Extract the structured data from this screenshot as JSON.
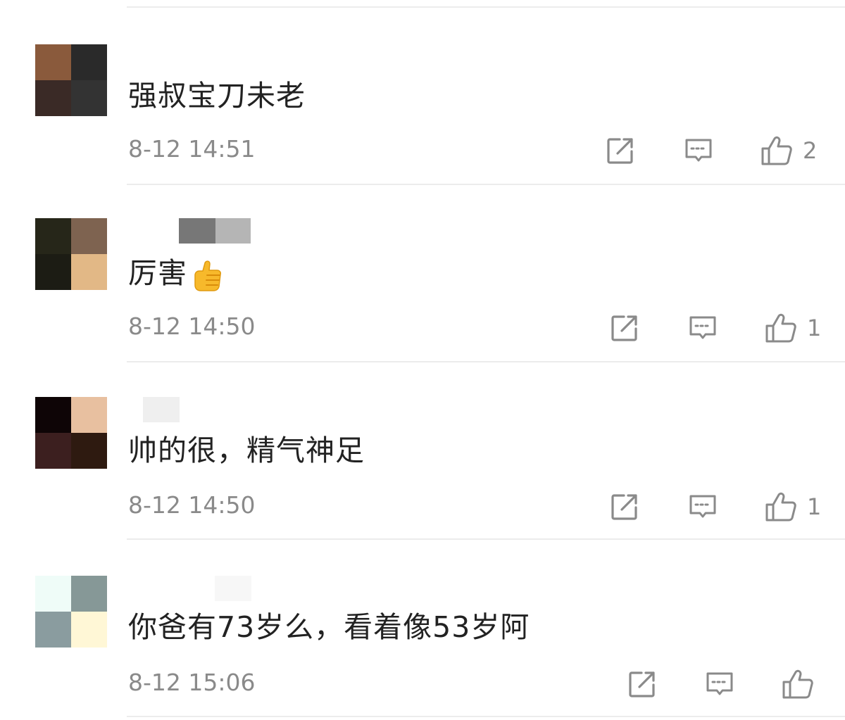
{
  "comments": [
    {
      "text": "强叔宝刀未老",
      "time": "8-12 14:51",
      "likes": "2",
      "avatar_colors": [
        "#8a5a3c",
        "#2a2a2a",
        "#3a2a26",
        "#333333"
      ],
      "username_blocks": []
    },
    {
      "text": "厉害",
      "emoji": "thumbs-up-emoji",
      "time": "8-12 14:50",
      "likes": "1",
      "avatar_colors": [
        "#262619",
        "#7e6350",
        "#1c1c14",
        "#e2b886"
      ],
      "username_blocks": [
        "#777777",
        "#b5b5b5"
      ]
    },
    {
      "text": "帅的很，精气神足",
      "time": "8-12 14:50",
      "likes": "1",
      "avatar_colors": [
        "#0e0506",
        "#e8c0a0",
        "#3c1f1f",
        "#2e1a10"
      ],
      "username_blocks": [
        "#efefef"
      ]
    },
    {
      "text": "你爸有73岁么，看着像53岁阿",
      "time": "8-12 15:06",
      "likes": "",
      "avatar_colors": [
        "#effcf8",
        "#869897",
        "#8a9c9f",
        "#fff7d6"
      ],
      "username_blocks": [
        "#f7f7f7"
      ]
    }
  ],
  "icons": {
    "share": "share-icon",
    "reply": "comment-icon",
    "like": "thumbs-up-icon"
  },
  "colors": {
    "text_primary": "#222222",
    "text_secondary": "#8a8a8a",
    "divider": "#ececec"
  }
}
